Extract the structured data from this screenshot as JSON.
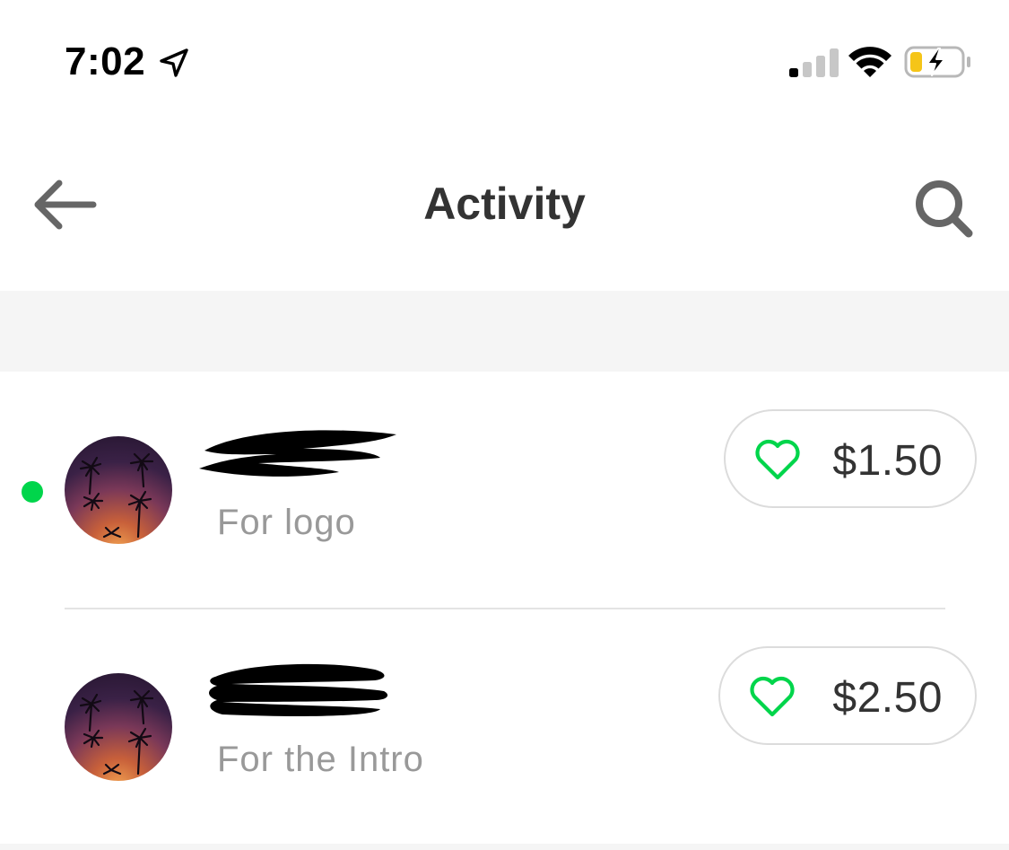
{
  "status_bar": {
    "time": "7:02",
    "icons": [
      "location-arrow-icon",
      "cellular-signal-icon",
      "wifi-icon",
      "battery-charging-icon"
    ]
  },
  "nav": {
    "title": "Activity",
    "back_icon": "arrow-left-icon",
    "search_icon": "search-icon"
  },
  "activity": {
    "items": [
      {
        "note": "For logo",
        "amount": "$1.50",
        "unread": true,
        "liked": false
      },
      {
        "note": "For the Intro",
        "amount": "$2.50",
        "unread": false,
        "liked": false
      }
    ]
  },
  "colors": {
    "accent_green": "#00d54b",
    "title_text": "#333333",
    "secondary_text": "#999999",
    "battery_fill": "#f5c518"
  }
}
